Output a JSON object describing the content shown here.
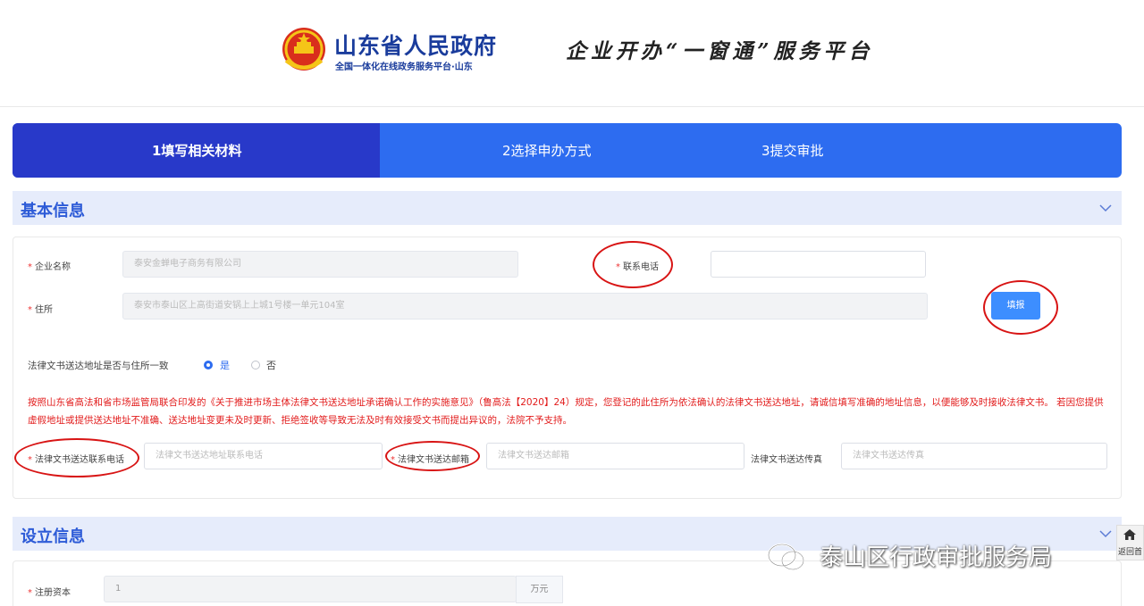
{
  "header": {
    "gov_title": "山东省人民政府",
    "gov_subtitle": "全国一体化在线政务服务平台·山东",
    "platform_title": "企业开办“一窗通”服务平台",
    "emblem_icon": "national-emblem-icon"
  },
  "steps": [
    {
      "label": "1填写相关材料",
      "active": true
    },
    {
      "label": "2选择申办方式",
      "active": false
    },
    {
      "label": "3提交审批",
      "active": false
    }
  ],
  "basic_info": {
    "title": "基本信息",
    "company_name": {
      "label": "企业名称",
      "value": "泰安金蝉电子商务有限公司"
    },
    "contact_phone": {
      "label": "联系电话",
      "value": ""
    },
    "address": {
      "label": "住所",
      "value": "泰安市泰山区上高街道安锅上上城1号楼一单元104室"
    },
    "fill_button": "填报",
    "same_address": {
      "label": "法律文书送达地址是否与住所一致",
      "options": [
        "是",
        "否"
      ],
      "selected": "是"
    },
    "notice": "按照山东省高法和省市场监管局联合印发的《关于推进市场主体法律文书送达地址承诺确认工作的实施意见》（鲁高法【2020】24）规定，您登记的此住所为依法确认的法律文书送达地址，请诚信填写准确的地址信息，以便能够及时接收法律文书。 若因您提供虚假地址或提供送达地址不准确、送达地址变更未及时更新、拒绝签收等导致无法及时有效接受文书而提出异议的，法院不予支持。",
    "legal_phone": {
      "label": "法律文书送达联系电话",
      "placeholder": "法律文书送达地址联系电话"
    },
    "legal_email": {
      "label": "法律文书送达邮箱",
      "placeholder": "法律文书送达邮箱"
    },
    "legal_fax": {
      "label": "法律文书送达传真",
      "placeholder": "法律文书送达传真"
    }
  },
  "setup_info": {
    "title": "设立信息",
    "registered_capital": {
      "label": "注册资本",
      "value": "1",
      "unit": "万元"
    }
  },
  "watermark": "泰山区行政审批服务局",
  "back_home": "返回首",
  "colors": {
    "primary": "#2d6cf0",
    "active_step": "#2839c9",
    "section_bg": "#e6ecfb",
    "section_title": "#2d5bd7",
    "notice": "#e21b1b",
    "annotation": "#d81414"
  }
}
